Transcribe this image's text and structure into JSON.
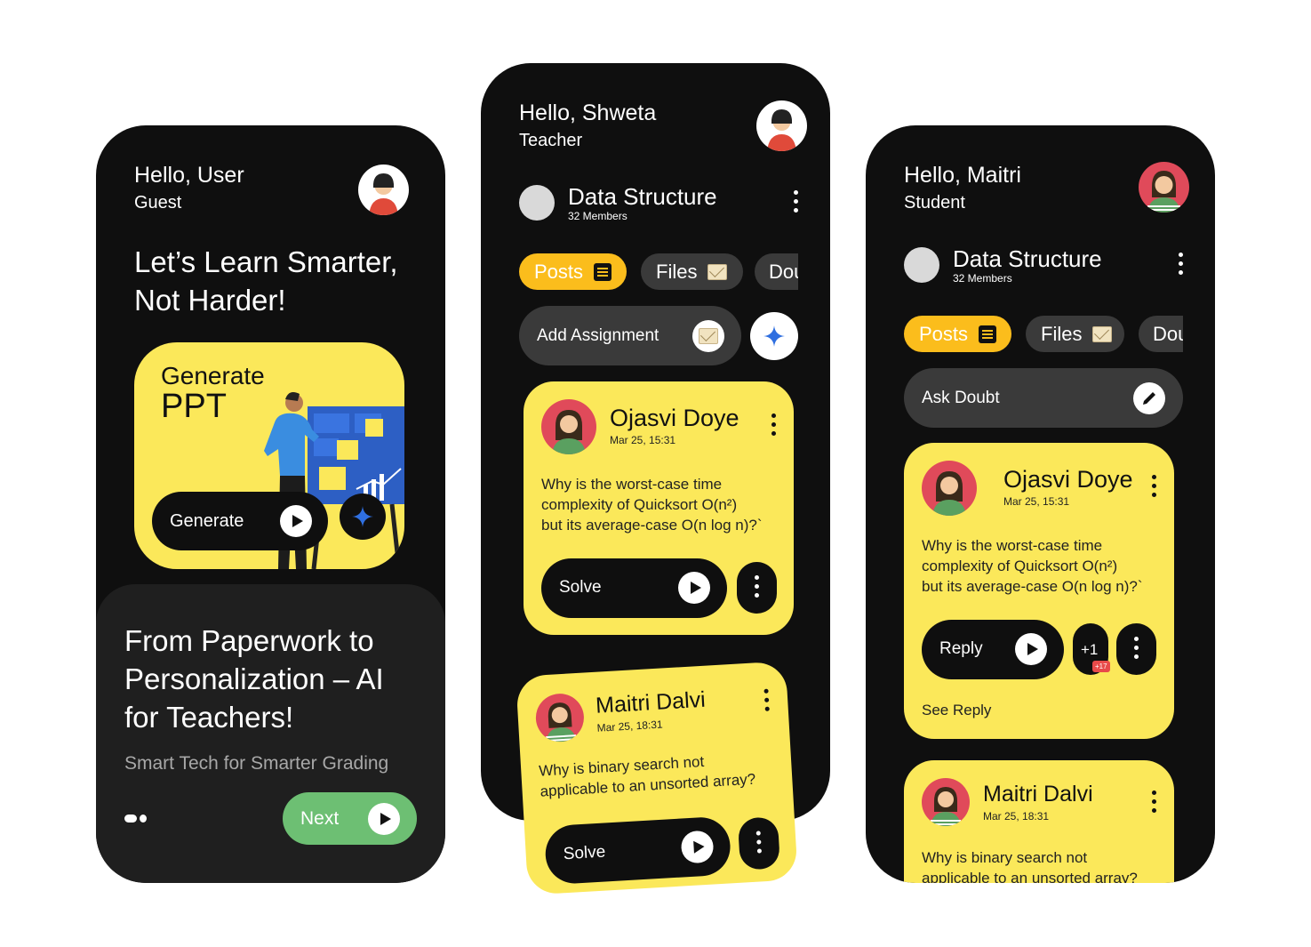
{
  "colors": {
    "background": "#ffffff",
    "phone": "#0f0f0f",
    "yellow": "#fbe85a",
    "orange": "#fbbd1c",
    "green": "#6dbf73",
    "pill_grey": "#3a3a3a",
    "star_blue": "#2f6fe0"
  },
  "phone1": {
    "greeting": "Hello, User",
    "role": "Guest",
    "headline_line1": "Let’s Learn Smarter,",
    "headline_line2": "Not Harder!",
    "promo_title_line1": "Generate",
    "promo_title_line2": "PPT",
    "generate_button": "Generate",
    "panel_title_line1": "From Paperwork to",
    "panel_title_line2": "Personalization – AI",
    "panel_title_line3": "for Teachers!",
    "panel_subtitle": "Smart Tech for Smarter Grading",
    "next_button": "Next"
  },
  "phone2": {
    "greeting": "Hello, Shweta",
    "role": "Teacher",
    "group_name": "Data Structure",
    "group_members": "32 Members",
    "tabs": [
      "Posts",
      "Files",
      "Dou"
    ],
    "action_pill": "Add Assignment",
    "posts": [
      {
        "author": "Ojasvi Doye",
        "date": "Mar 25, 15:31",
        "q1": "Why is the worst-case time",
        "q2": "complexity of Quicksort O(n²)",
        "q3": "but its average-case O(n log n)?`",
        "button": "Solve"
      },
      {
        "author": "Maitri Dalvi",
        "date": "Mar 25, 18:31",
        "q1": "Why is binary search not",
        "q2": "applicable to an unsorted array?",
        "button": "Solve"
      }
    ]
  },
  "phone3": {
    "greeting": "Hello, Maitri",
    "role": "Student",
    "group_name": "Data Structure",
    "group_members": "32 Members",
    "tabs": [
      "Posts",
      "Files",
      "Dou"
    ],
    "action_pill": "Ask Doubt",
    "posts": [
      {
        "author": "Ojasvi Doye",
        "date": "Mar 25, 15:31",
        "q1": "Why is the worst-case time",
        "q2": "complexity of Quicksort O(n²)",
        "q3": "but its average-case O(n log n)?`",
        "button": "Reply",
        "reply_count": "+1",
        "badge": "+17",
        "see_reply": "See Reply"
      },
      {
        "author": "Maitri Dalvi",
        "date": "Mar 25, 18:31",
        "q1": "Why is binary search not",
        "q2": "applicable to an unsorted array?"
      }
    ]
  }
}
